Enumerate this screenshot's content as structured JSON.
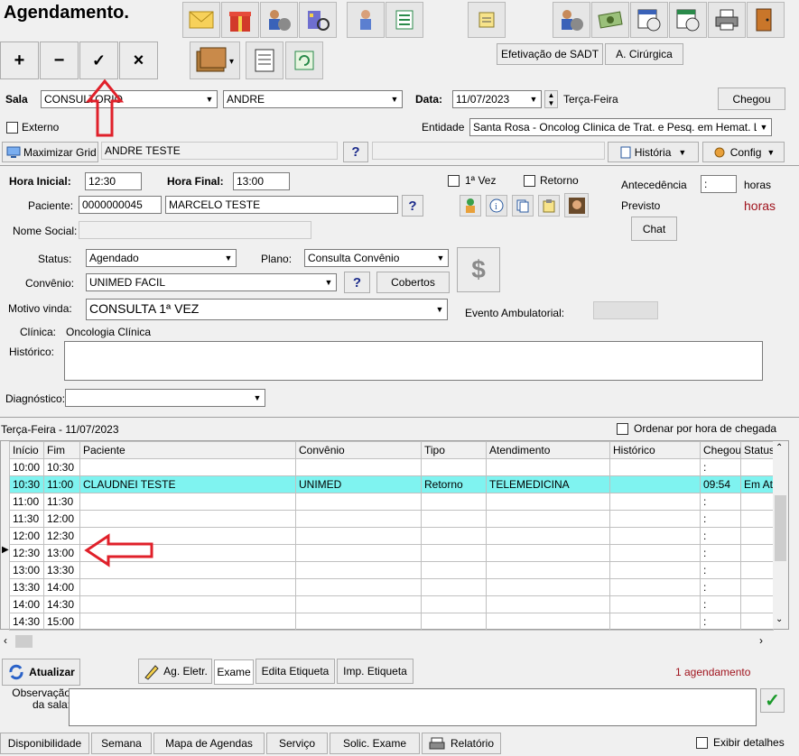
{
  "window_title": "Agendamento.",
  "nav": {
    "add": "+",
    "remove": "−",
    "confirm": "✓",
    "cancel": "×"
  },
  "buttons": {
    "efetivacao": "Efetivação de SADT",
    "cirurgica": "A. Cirúrgica",
    "chegou": "Chegou",
    "maximizar": "Maximizar Grid",
    "historia": "História",
    "config": "Config",
    "chat": "Chat",
    "cobertos": "Cobertos",
    "atualizar": "Atualizar",
    "ag_eletr": "Ag. Eletr.",
    "exame": "Exame",
    "edita_etiqueta": "Edita Etiqueta",
    "imp_etiqueta": "Imp. Etiqueta",
    "question": "?"
  },
  "header": {
    "sala_label": "Sala",
    "sala_value": "CONSULTORIO",
    "medico_value": "ANDRE",
    "data_label": "Data:",
    "data_value": "11/07/2023",
    "weekday": "Terça-Feira",
    "externo_label": "Externo",
    "entidade_label": "Entidade",
    "entidade_value": "Santa Rosa - Oncolog Clinica de Trat. e Pesq. em Hemat. L",
    "grid_user": "ANDRE TESTE"
  },
  "form": {
    "hora_inicial_label": "Hora Inicial:",
    "hora_inicial": "12:30",
    "hora_final_label": "Hora Final:",
    "hora_final": "13:00",
    "primeira_vez": "1ª Vez",
    "retorno": "Retorno",
    "antecedencia_label": "Antecedência",
    "antecedencia_value": ":",
    "horas_unit": "horas",
    "previsto_label": "Previsto",
    "previsto_value": "horas",
    "paciente_label": "Paciente:",
    "paciente_id": "0000000045",
    "paciente_nome": "MARCELO TESTE",
    "nome_social_label": "Nome Social:",
    "status_label": "Status:",
    "status_value": "Agendado",
    "plano_label": "Plano:",
    "plano_value": "Consulta Convênio",
    "convenio_label": "Convênio:",
    "convenio_value": "UNIMED FACIL",
    "motivo_label": "Motivo vinda:",
    "motivo_value": "CONSULTA 1ª VEZ",
    "evento_label": "Evento Ambulatorial:",
    "clinica_label": "Clínica:",
    "clinica_value": "Oncologia Clínica",
    "historico_label": "Histórico:",
    "diagnostico_label": "Diagnóstico:"
  },
  "grid": {
    "date_title": "Terça-Feira - 11/07/2023",
    "ordenar_label": "Ordenar por hora de chegada",
    "columns": [
      "Início",
      "Fim",
      "Paciente",
      "Convênio",
      "Tipo",
      "Atendimento",
      "Histórico",
      "Chegou",
      "Status"
    ],
    "rows": [
      [
        "10:00",
        "10:30",
        "",
        "",
        "",
        "",
        "",
        ":",
        ""
      ],
      [
        "10:30",
        "11:00",
        "CLAUDNEI TESTE",
        "UNIMED",
        "Retorno",
        "TELEMEDICINA",
        "",
        "09:54",
        "Em At"
      ],
      [
        "11:00",
        "11:30",
        "",
        "",
        "",
        "",
        "",
        ":",
        ""
      ],
      [
        "11:30",
        "12:00",
        "",
        "",
        "",
        "",
        "",
        ":",
        ""
      ],
      [
        "12:00",
        "12:30",
        "",
        "",
        "",
        "",
        "",
        ":",
        ""
      ],
      [
        "12:30",
        "13:00",
        "",
        "",
        "",
        "",
        "",
        ":",
        ""
      ],
      [
        "13:00",
        "13:30",
        "",
        "",
        "",
        "",
        "",
        ":",
        ""
      ],
      [
        "13:30",
        "14:00",
        "",
        "",
        "",
        "",
        "",
        ":",
        ""
      ],
      [
        "14:00",
        "14:30",
        "",
        "",
        "",
        "",
        "",
        ":",
        ""
      ],
      [
        "14:30",
        "15:00",
        "",
        "",
        "",
        "",
        "",
        ":",
        ""
      ]
    ],
    "count_text": "1 agendamento"
  },
  "footer": {
    "observacao_label": "Observação da sala:",
    "tabs": [
      "Disponibilidade",
      "Semana",
      "Mapa de Agendas",
      "Serviço",
      "Solic. Exame",
      "Relatório"
    ],
    "exibir_label": "Exibir detalhes"
  },
  "colors": {
    "highlight_row": "#7ff3f0",
    "annotation_arrow": "#e0202a",
    "previsto": "#a0141e",
    "count_text": "#a0141e"
  }
}
